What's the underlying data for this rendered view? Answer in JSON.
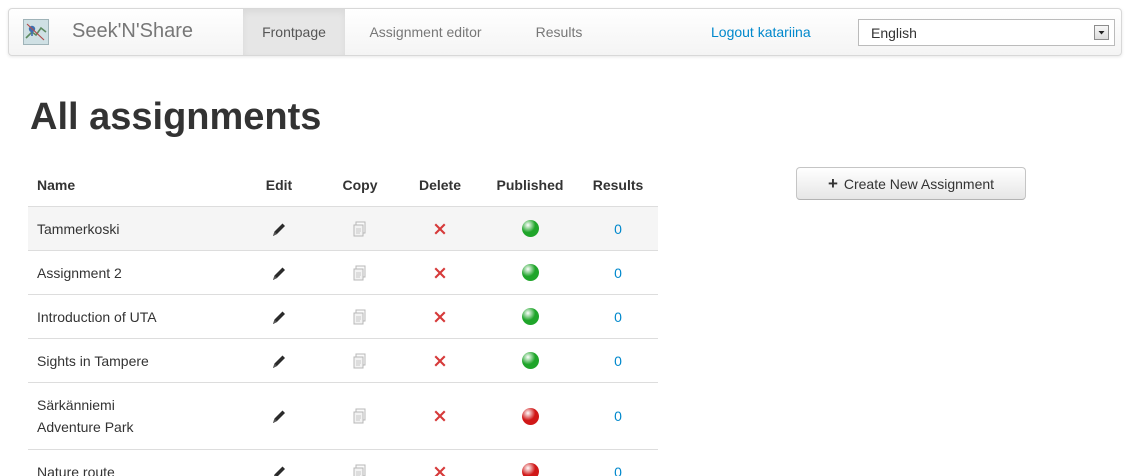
{
  "app": {
    "brand_name": "Seek'N'Share",
    "logo_icon": "map-logo-icon"
  },
  "nav": {
    "tabs": [
      {
        "label": "Frontpage",
        "active": true
      },
      {
        "label": "Assignment editor",
        "active": false
      },
      {
        "label": "Results",
        "active": false
      }
    ],
    "logout_label": "Logout katariina",
    "language": {
      "selected": "English"
    }
  },
  "main": {
    "title": "All assignments",
    "create_button_label": "Create New Assignment",
    "create_button_icon": "plus-icon",
    "table": {
      "columns": [
        "Name",
        "Edit",
        "Copy",
        "Delete",
        "Published",
        "Results"
      ],
      "rows": [
        {
          "name": "Tammerkoski",
          "published": true,
          "results": "0"
        },
        {
          "name": "Assignment 2",
          "published": true,
          "results": "0"
        },
        {
          "name": "Introduction of UTA",
          "published": true,
          "results": "0"
        },
        {
          "name": "Sights in Tampere",
          "published": true,
          "results": "0"
        },
        {
          "name": "Särkänniemi\nAdventure Park",
          "published": false,
          "results": "0"
        },
        {
          "name": "Nature route",
          "published": false,
          "results": "0"
        }
      ]
    }
  },
  "icons": {
    "edit": "pencil-icon",
    "copy": "copy-icon",
    "delete": "delete-x-icon",
    "published_yes": "green-status-icon",
    "published_no": "red-status-icon"
  },
  "colors": {
    "link": "#0088cc",
    "published_yes": "#1fa52a",
    "published_no": "#d01818",
    "delete": "#d63a3a",
    "active_tab_bg": "#e6e6e6"
  }
}
